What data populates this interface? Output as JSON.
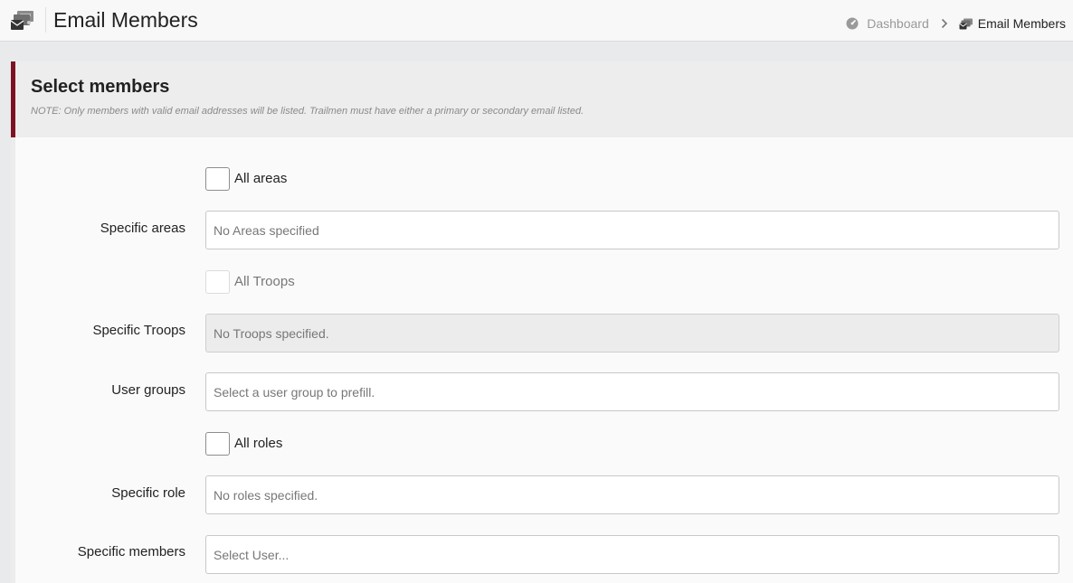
{
  "header": {
    "title": "Email Members",
    "app_icon": "email-members-icon",
    "breadcrumb": {
      "dashboard_label": "Dashboard",
      "dashboard_icon": "dashboard-gauge-icon",
      "separator_icon": "chevron-right-icon",
      "current_label": "Email Members",
      "current_icon": "email-members-icon"
    }
  },
  "section": {
    "title": "Select members",
    "note": "NOTE: Only members with valid email addresses will be listed. Trailmen must have either a primary or secondary email listed."
  },
  "form": {
    "all_areas": {
      "label": "All areas",
      "checked": false
    },
    "specific_areas": {
      "label": "Specific areas",
      "placeholder": "No Areas specified"
    },
    "all_troops": {
      "label": "All Troops",
      "checked": false,
      "disabled": true
    },
    "specific_troops": {
      "label": "Specific Troops",
      "placeholder": "No Troops specified.",
      "disabled": true
    },
    "user_groups": {
      "label": "User groups",
      "placeholder": "Select a user group to prefill."
    },
    "all_roles": {
      "label": "All roles",
      "checked": false
    },
    "specific_role": {
      "label": "Specific role",
      "placeholder": "No roles specified."
    },
    "specific_members": {
      "label": "Specific members",
      "placeholder": "Select User..."
    }
  },
  "colors": {
    "accent": "#7d1323",
    "header_bg": "#ededed",
    "panel_bg": "#fafafa",
    "page_bg": "#e9eaec"
  }
}
